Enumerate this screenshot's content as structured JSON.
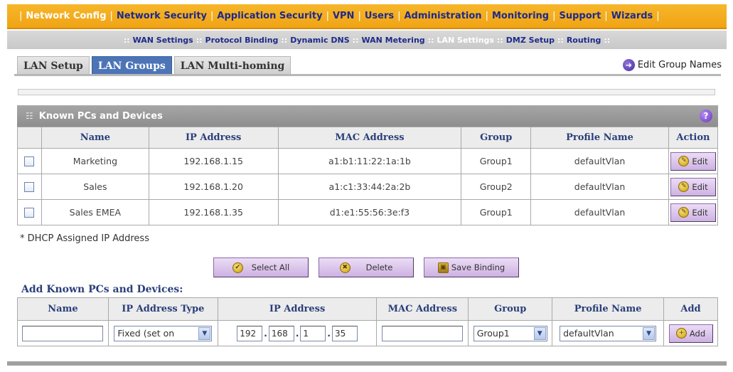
{
  "top_nav": {
    "items": [
      {
        "label": "Network Config",
        "active": true
      },
      {
        "label": "Network Security",
        "active": false
      },
      {
        "label": "Application Security",
        "active": false
      },
      {
        "label": "VPN",
        "active": false
      },
      {
        "label": "Users",
        "active": false
      },
      {
        "label": "Administration",
        "active": false
      },
      {
        "label": "Monitoring",
        "active": false
      },
      {
        "label": "Support",
        "active": false
      },
      {
        "label": "Wizards",
        "active": false
      }
    ]
  },
  "sub_nav": {
    "items": [
      {
        "label": "WAN Settings",
        "active": false
      },
      {
        "label": "Protocol Binding",
        "active": false
      },
      {
        "label": "Dynamic DNS",
        "active": false
      },
      {
        "label": "WAN Metering",
        "active": false
      },
      {
        "label": "LAN Settings",
        "active": true
      },
      {
        "label": "DMZ Setup",
        "active": false
      },
      {
        "label": "Routing",
        "active": false
      }
    ]
  },
  "tabs": [
    {
      "label": "LAN Setup",
      "active": false
    },
    {
      "label": "LAN Groups",
      "active": true
    },
    {
      "label": "LAN Multi-homing",
      "active": false
    }
  ],
  "edit_group_names": "Edit Group Names",
  "known_pcs": {
    "title": "Known PCs and Devices",
    "help": "?",
    "columns": [
      "Name",
      "IP Address",
      "MAC Address",
      "Group",
      "Profile Name",
      "Action"
    ],
    "rows": [
      {
        "name": "Marketing",
        "ip": "192.168.1.15",
        "mac": "a1:b1:11:22:1a:1b",
        "group": "Group1",
        "profile": "defaultVlan",
        "action": "Edit"
      },
      {
        "name": "Sales",
        "ip": "192.168.1.20",
        "mac": "a1:c1:33:44:2a:2b",
        "group": "Group2",
        "profile": "defaultVlan",
        "action": "Edit"
      },
      {
        "name": "Sales EMEA",
        "ip": "192.168.1.35",
        "mac": "d1:e1:55:56:3e:f3",
        "group": "Group1",
        "profile": "defaultVlan",
        "action": "Edit"
      }
    ]
  },
  "dhcp_note": "* DHCP Assigned IP Address",
  "buttons": {
    "select_all": "Select All",
    "delete": "Delete",
    "save_binding": "Save Binding"
  },
  "add_section": {
    "title": "Add Known PCs and Devices:",
    "columns": [
      "Name",
      "IP Address Type",
      "IP Address",
      "MAC Address",
      "Group",
      "Profile Name",
      "Add"
    ],
    "name_value": "",
    "ip_type": "Fixed (set on",
    "ip_octets": [
      "192",
      "168",
      "1",
      "35"
    ],
    "mac_value": "",
    "group": "Group1",
    "profile": "defaultVlan",
    "add_label": "Add"
  }
}
